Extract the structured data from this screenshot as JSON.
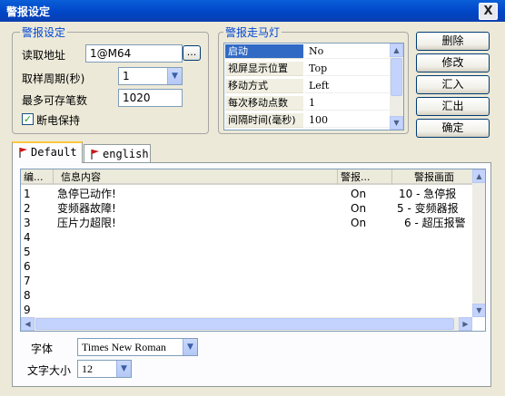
{
  "window": {
    "title": "警报设定",
    "close_glyph": "X"
  },
  "alarm_settings": {
    "legend": "警报设定",
    "read_address_label": "读取地址",
    "read_address_value": "1@M64",
    "browse_button": "...",
    "sample_period_label": "取样周期(秒)",
    "sample_period_value": "1",
    "max_records_label": "最多可存笔数",
    "max_records_value": "1020",
    "power_off_keep_label": "断电保持",
    "power_off_keep_checked": true
  },
  "marquee": {
    "legend": "警报走马灯",
    "rows": [
      {
        "name": "启动",
        "value": "No"
      },
      {
        "name": "视屏显示位置",
        "value": "Top"
      },
      {
        "name": "移动方式",
        "value": "Left"
      },
      {
        "name": "每次移动点数",
        "value": "1"
      },
      {
        "name": "间隔时间(毫秒)",
        "value": "100"
      }
    ]
  },
  "buttons": {
    "delete": "删除",
    "modify": "修改",
    "import": "汇入",
    "export": "汇出",
    "ok": "确定"
  },
  "tabs": [
    {
      "label": "Default"
    },
    {
      "label": "english"
    }
  ],
  "alarm_list": {
    "columns": [
      "编...",
      "信息内容",
      "警报...",
      "警报画面"
    ],
    "rows": [
      {
        "no": "1",
        "message": "急停已动作!",
        "state": "On",
        "screen": "10 - 急停报"
      },
      {
        "no": "2",
        "message": "变频器故障!",
        "state": "On",
        "screen": "5 - 变频器报"
      },
      {
        "no": "3",
        "message": "压片力超限!",
        "state": "On",
        "screen": "6 - 超压报警"
      },
      {
        "no": "4",
        "message": "",
        "state": "",
        "screen": ""
      },
      {
        "no": "5",
        "message": "",
        "state": "",
        "screen": ""
      },
      {
        "no": "6",
        "message": "",
        "state": "",
        "screen": ""
      },
      {
        "no": "7",
        "message": "",
        "state": "",
        "screen": ""
      },
      {
        "no": "8",
        "message": "",
        "state": "",
        "screen": ""
      },
      {
        "no": "9",
        "message": "",
        "state": "",
        "screen": ""
      }
    ]
  },
  "font": {
    "label": "字体",
    "value": "Times New Roman"
  },
  "text_size": {
    "label": "文字大小",
    "value": "12"
  },
  "colors": {
    "title_bar": "#0046c7",
    "legend": "#0046d5",
    "selection": "#316ac5",
    "tab_highlight": "#ffc83c"
  }
}
